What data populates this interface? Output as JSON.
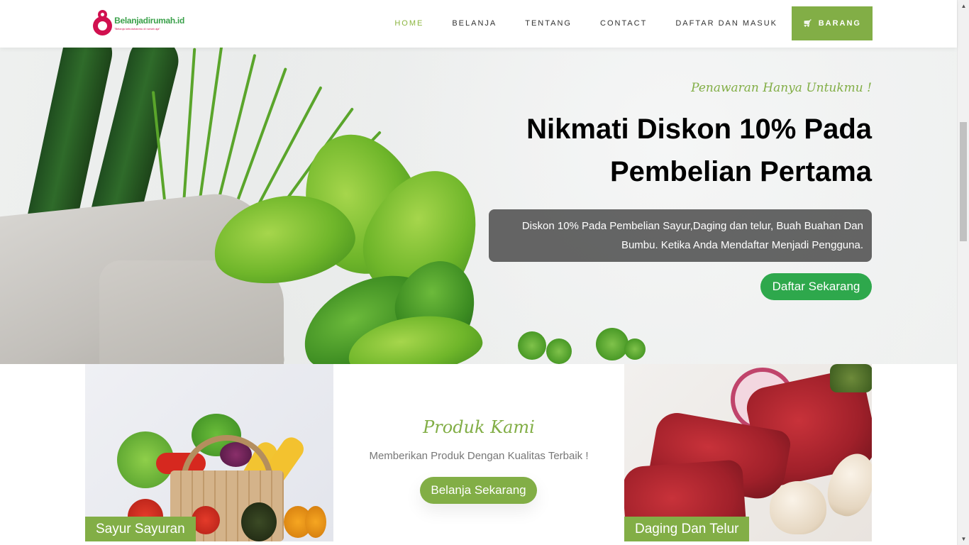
{
  "brand": {
    "name": "Belanjadirumah.id",
    "tagline": "\"Belanja kebutuhanmu di rumah aja\"",
    "primary_color": "#82ae46",
    "accent_color": "#d1104f"
  },
  "nav": {
    "items": [
      {
        "label": "HOME",
        "active": true
      },
      {
        "label": "BELANJA",
        "active": false
      },
      {
        "label": "TENTANG",
        "active": false
      },
      {
        "label": "CONTACT",
        "active": false
      },
      {
        "label": "DAFTAR DAN MASUK",
        "active": false
      }
    ],
    "cart_label": "BARANG",
    "cart_icon": "cart-icon"
  },
  "hero": {
    "eyebrow": "Penawaran Hanya Untukmu !",
    "title": "Nikmati Diskon 10% Pada Pembelian Pertama",
    "description": "Diskon 10% Pada Pembelian Sayur,Daging dan telur, Buah Buahan Dan Bumbu. Ketika Anda Mendaftar Menjadi Pengguna.",
    "cta_label": "Daftar Sekarang",
    "cta_color": "#2ea84c"
  },
  "products": {
    "title": "Produk Kami",
    "subtitle": "Memberikan Produk Dengan Kualitas Terbaik !",
    "cta_label": "Belanja Sekarang",
    "cards": [
      {
        "label": "Sayur Sayuran"
      },
      {
        "label": "Daging Dan Telur"
      }
    ]
  }
}
